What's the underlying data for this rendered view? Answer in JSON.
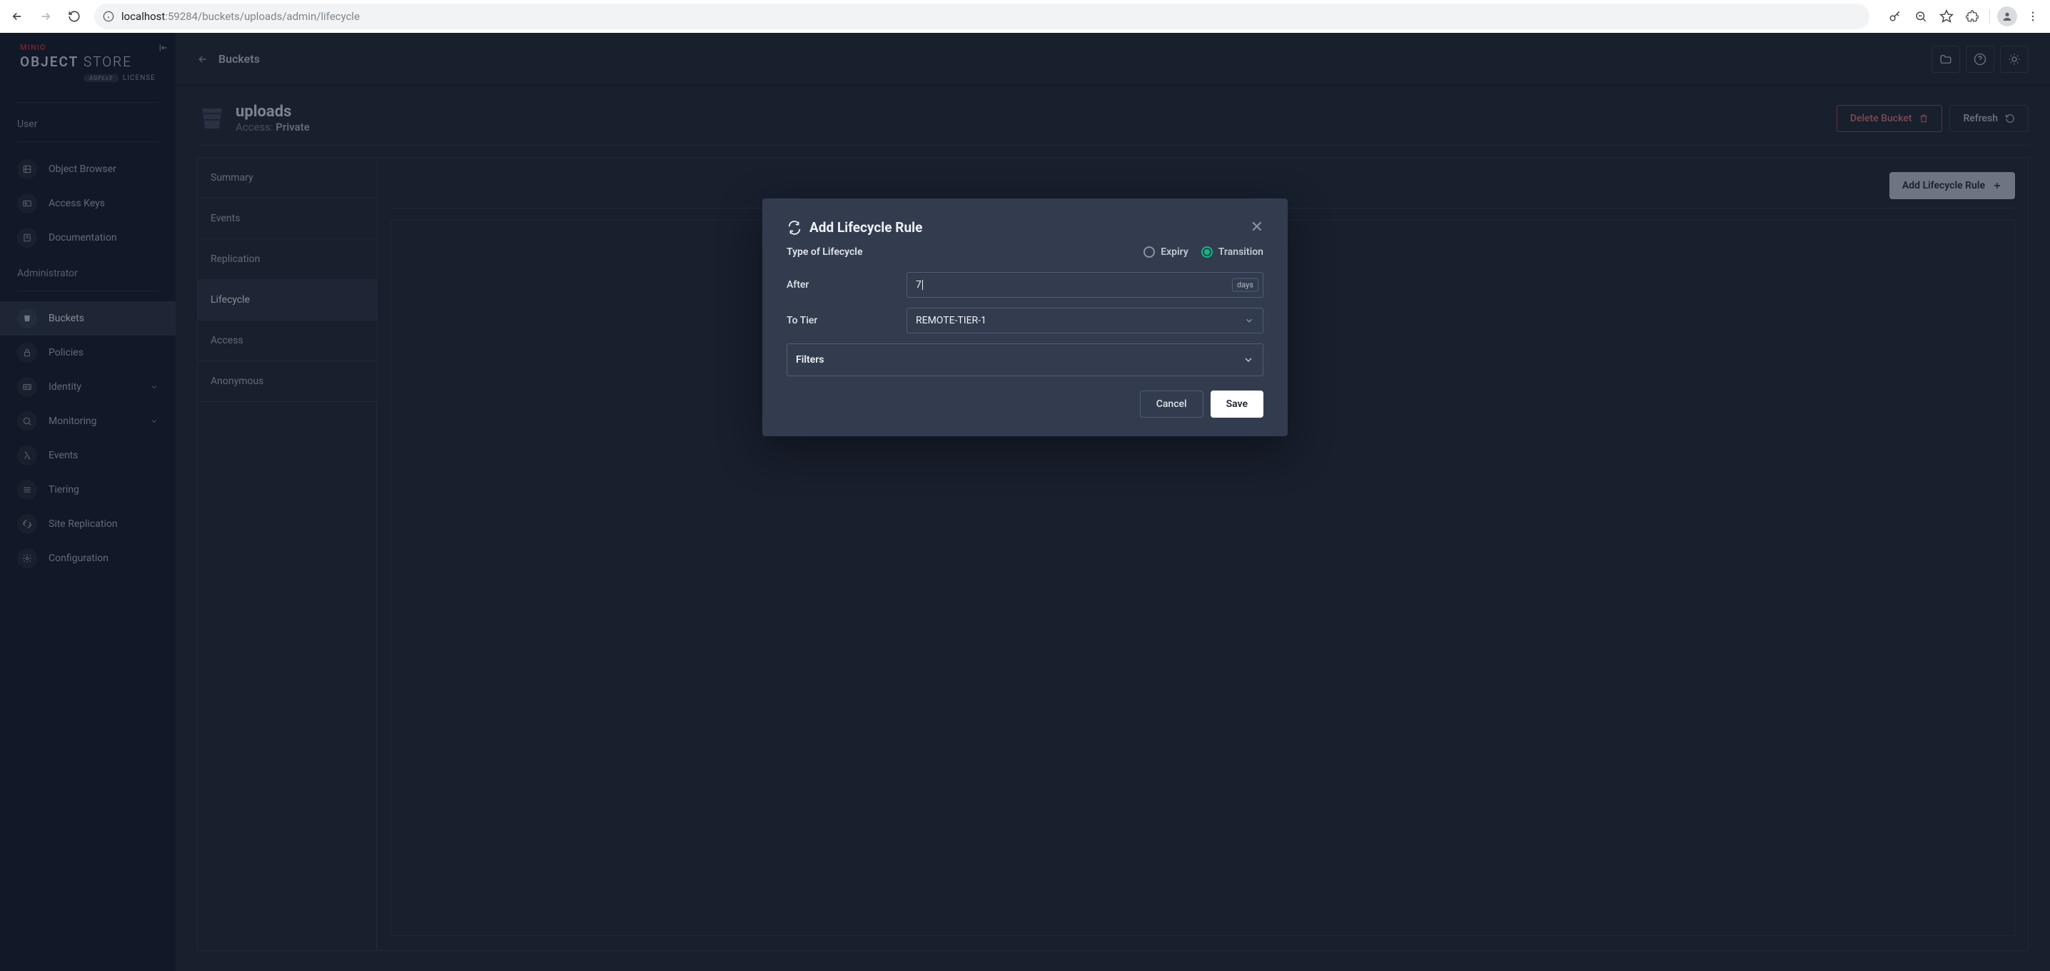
{
  "browser": {
    "url_host": "localhost",
    "url_port": ":59284",
    "url_path": "/buckets/uploads/admin/lifecycle"
  },
  "logo": {
    "brand": "MINIO",
    "main_a": "OBJECT",
    "main_b": "STORE",
    "badge": "AGPLv3",
    "license": "LICENSE"
  },
  "sidebar": {
    "section_user": "User",
    "section_admin": "Administrator",
    "user_items": [
      {
        "label": "Object Browser"
      },
      {
        "label": "Access Keys"
      },
      {
        "label": "Documentation"
      }
    ],
    "admin_items": [
      {
        "label": "Buckets"
      },
      {
        "label": "Policies"
      },
      {
        "label": "Identity",
        "expandable": true
      },
      {
        "label": "Monitoring",
        "expandable": true
      },
      {
        "label": "Events"
      },
      {
        "label": "Tiering"
      },
      {
        "label": "Site Replication"
      },
      {
        "label": "Configuration"
      }
    ]
  },
  "topbar": {
    "breadcrumb": "Buckets"
  },
  "bucket": {
    "name": "uploads",
    "access_label": "Access:",
    "access_value": "Private",
    "delete": "Delete Bucket",
    "refresh": "Refresh"
  },
  "tabs": [
    "Summary",
    "Events",
    "Replication",
    "Lifecycle",
    "Access",
    "Anonymous"
  ],
  "tab_content": {
    "add_rule": "Add Lifecycle Rule"
  },
  "modal": {
    "title": "Add Lifecycle Rule",
    "type_label": "Type of Lifecycle",
    "expiry": "Expiry",
    "transition": "Transition",
    "after_label": "After",
    "after_value": "7",
    "after_unit": "days",
    "tier_label": "To Tier",
    "tier_value": "REMOTE-TIER-1",
    "filters": "Filters",
    "cancel": "Cancel",
    "save": "Save"
  }
}
